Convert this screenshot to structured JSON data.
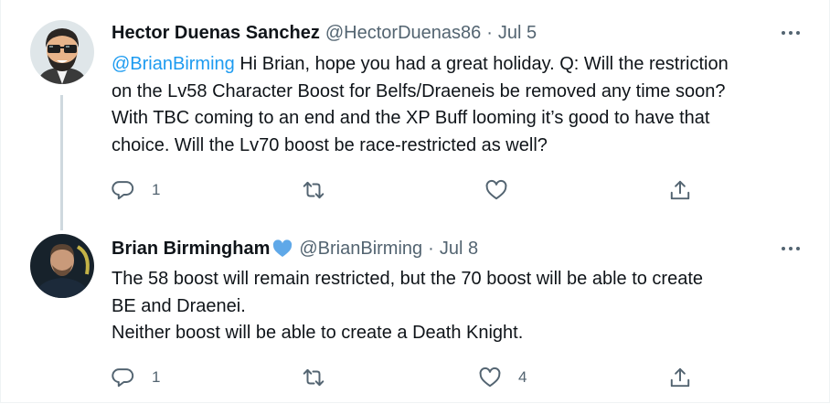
{
  "tweets": [
    {
      "author_name": "Hector Duenas Sanchez",
      "handle": "@HectorDuenas86",
      "separator": "·",
      "date": "Jul 5",
      "mention": "@BrianBirming",
      "text_lines": [
        " Hi Brian, hope you had a great holiday. Q: Will the restriction",
        "on the Lv58 Character Boost for Belfs/Draeneis be removed any time soon?",
        "With TBC coming to an end and the XP Buff looming it’s good to have that",
        "choice. Will the Lv70 boost be race-restricted as well?"
      ],
      "reply_count": "1",
      "retweet_count": "",
      "like_count": "",
      "avatar_icon": "cartoon-avatar-sunglasses"
    },
    {
      "author_name": "Brian Birmingham",
      "verified_icon": "heart-icon",
      "verified_color": "#5fa8e8",
      "handle": "@BrianBirming",
      "separator": "·",
      "date": "Jul 8",
      "text_lines": [
        "The 58 boost will remain restricted, but the 70 boost will be able to create",
        "BE and Draenei.",
        "Neither boost will be able to create a Death Knight."
      ],
      "reply_count": "1",
      "retweet_count": "",
      "like_count": "4",
      "avatar_icon": "photo-avatar"
    }
  ],
  "colors": {
    "accent": "#1d9bf0",
    "secondary_text": "#536471",
    "primary_text": "#0f1419",
    "thread_line": "#cfd9de"
  }
}
